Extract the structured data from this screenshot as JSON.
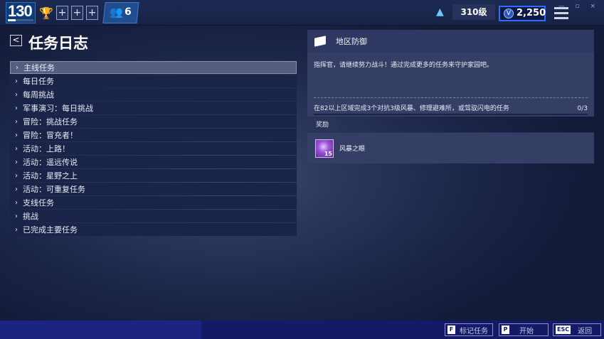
{
  "top_bar": {
    "level": "130",
    "level_progress": 0.3,
    "party_count": "6",
    "power_level": "310级",
    "vbucks": "2,250",
    "vbucks_symbol": "V",
    "plus_slots": [
      "+",
      "+",
      "+"
    ]
  },
  "page": {
    "back_symbol": "<",
    "title": "任务日志"
  },
  "quest_categories": [
    "主线任务",
    "每日任务",
    "每周挑战",
    "军事演习：每日挑战",
    "冒险：挑战任务",
    "冒险：冒充者！",
    "活动：上路！",
    "活动：遥远传说",
    "活动：星野之上",
    "活动：可重复任务",
    "支线任务",
    "挑战",
    "已完成主要任务"
  ],
  "active_category_index": 0,
  "detail": {
    "title": "地区防御",
    "description": "指挥官，请继续努力战斗！通过完成更多的任务来守护家园吧。",
    "objective_text": "在82以上区域完成3个对抗3级风暴、修理避难所，或驾驭闪电的任务",
    "objective_progress": "0/3",
    "reward_tab_label": "奖励",
    "reward_name": "风暴之眼",
    "reward_qty": "15"
  },
  "bottom_hints": [
    {
      "key": "F",
      "label": "标记任务"
    },
    {
      "key": "P",
      "label": "开始"
    },
    {
      "key": "ESC",
      "label": "返回"
    }
  ],
  "colors": {
    "accent_blue": "#2f6cff",
    "active_row": "#565e80",
    "reward_purple": "#9b53d6"
  }
}
